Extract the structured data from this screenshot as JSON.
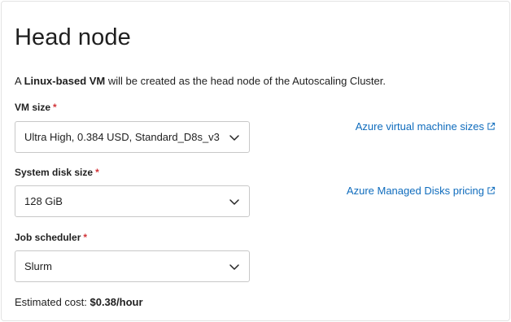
{
  "header": {
    "title": "Head node"
  },
  "intro": {
    "prefix": "A ",
    "bold": "Linux-based VM",
    "suffix": " will be created as the head node of the Autoscaling Cluster."
  },
  "fields": {
    "vm_size": {
      "label": "VM size",
      "required_mark": "*",
      "value": "Ultra High, 0.384 USD, Standard_D8s_v3"
    },
    "disk_size": {
      "label": "System disk size",
      "required_mark": "*",
      "value": "128 GiB"
    },
    "scheduler": {
      "label": "Job scheduler",
      "required_mark": "*",
      "value": "Slurm"
    }
  },
  "links": {
    "vm_sizes": "Azure virtual machine sizes",
    "disk_pricing": "Azure Managed Disks pricing"
  },
  "cost": {
    "label": "Estimated cost: ",
    "value": "$0.38/hour"
  },
  "colors": {
    "link": "#0f6cbd",
    "required": "#d13438",
    "border": "#c8c8c8"
  },
  "icons": {
    "dropdown": "chevron-down-icon",
    "external": "external-link-icon"
  }
}
